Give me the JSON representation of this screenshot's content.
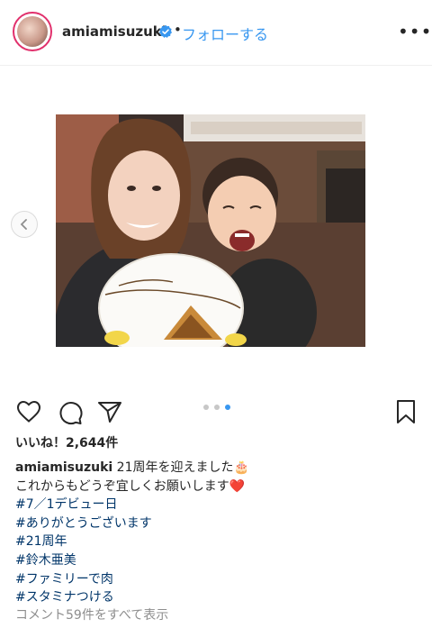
{
  "header": {
    "username": "amiamisuzuki",
    "separator": "•",
    "follow_label": "フォローする",
    "more_label": "•••"
  },
  "post": {
    "likes_text": "いいね！2,644件",
    "carousel": {
      "total": 3,
      "active_index": 2
    },
    "caption": {
      "username": "amiamisuzuki",
      "line1": "21周年を迎えました🎂",
      "line2": "これからもどうぞ宜しくお願いします❤️",
      "hashtags": [
        "#7／1デビュー日",
        "#ありがとうございます",
        "#21周年",
        "#鈴木亜美",
        "#ファミリーで肉",
        "#スタミナつける"
      ]
    },
    "comments_link": "コメント59件をすべて表示"
  },
  "colors": {
    "link_blue": "#3897f0",
    "hashtag": "#003569",
    "muted": "#8e8e8e",
    "heart": "#e0245e"
  },
  "icons": [
    "verified-badge-icon",
    "chevron-left-icon",
    "heart-icon",
    "comment-icon",
    "share-icon",
    "bookmark-icon",
    "more-options-icon"
  ]
}
